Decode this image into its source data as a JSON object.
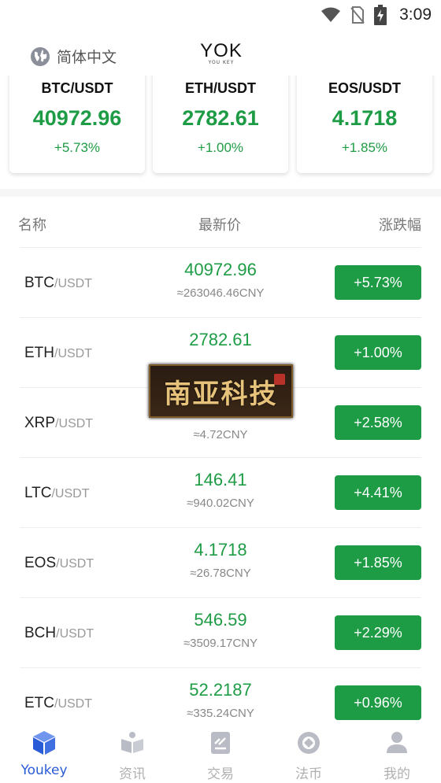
{
  "status_bar": {
    "time": "3:09"
  },
  "header": {
    "language": "简体中文",
    "logo": "YOK",
    "logo_sub": "YOU KEY"
  },
  "cards": [
    {
      "pair": "BTC/USDT",
      "price": "40972.96",
      "change": "+5.73%"
    },
    {
      "pair": "ETH/USDT",
      "price": "2782.61",
      "change": "+1.00%"
    },
    {
      "pair": "EOS/USDT",
      "price": "4.1718",
      "change": "+1.85%"
    }
  ],
  "table": {
    "headers": {
      "name": "名称",
      "price": "最新价",
      "change": "涨跌幅"
    },
    "rows": [
      {
        "coin": "BTC",
        "quote": "/USDT",
        "price": "40972.96",
        "cny": "≈263046.46CNY",
        "change": "+5.73%"
      },
      {
        "coin": "ETH",
        "quote": "/USDT",
        "price": "2782.61",
        "cny": "",
        "change": "+1.00%"
      },
      {
        "coin": "XRP",
        "quote": "/USDT",
        "price": "",
        "cny": "≈4.72CNY",
        "change": "+2.58%"
      },
      {
        "coin": "LTC",
        "quote": "/USDT",
        "price": "146.41",
        "cny": "≈940.02CNY",
        "change": "+4.41%"
      },
      {
        "coin": "EOS",
        "quote": "/USDT",
        "price": "4.1718",
        "cny": "≈26.78CNY",
        "change": "+1.85%"
      },
      {
        "coin": "BCH",
        "quote": "/USDT",
        "price": "546.59",
        "cny": "≈3509.17CNY",
        "change": "+2.29%"
      },
      {
        "coin": "ETC",
        "quote": "/USDT",
        "price": "52.2187",
        "cny": "≈335.24CNY",
        "change": "+0.96%"
      }
    ]
  },
  "watermark": {
    "text": "南亚科技"
  },
  "tabbar": {
    "items": [
      {
        "label": "Youkey",
        "icon": "cube-icon",
        "active": true
      },
      {
        "label": "资讯",
        "icon": "book-icon",
        "active": false
      },
      {
        "label": "交易",
        "icon": "document-icon",
        "active": false
      },
      {
        "label": "法币",
        "icon": "coin-icon",
        "active": false
      },
      {
        "label": "我的",
        "icon": "user-icon",
        "active": false
      }
    ]
  },
  "colors": {
    "up": "#1e9c45",
    "active_tab": "#2a5bd7",
    "inactive_tab": "#b0b0b0"
  }
}
